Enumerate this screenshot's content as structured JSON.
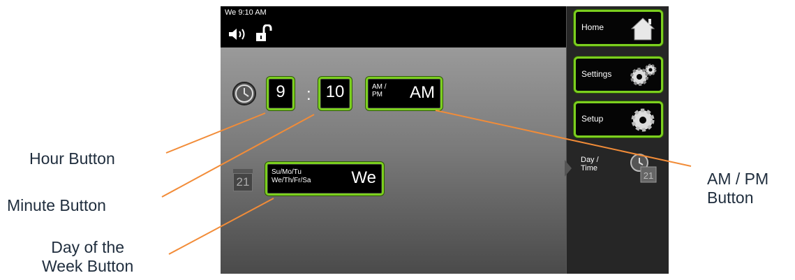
{
  "status": {
    "datetime": "We 9:10 AM"
  },
  "time": {
    "hour": "9",
    "separator": ":",
    "minute": "10",
    "ampm_small": "AM /\nPM",
    "ampm_value": "AM"
  },
  "day": {
    "small": "Su/Mo/Tu\nWe/Th/Fr/Sa",
    "value": "We",
    "calendar_number": "21"
  },
  "sidebar": {
    "home": "Home",
    "settings": "Settings",
    "setup": "Setup",
    "active_tab": "Day /\nTime",
    "tab_calendar_number": "21"
  },
  "callouts": {
    "hour": "Hour Button",
    "minute": "Minute Button",
    "day_of_week": "Day of the\nWeek Button",
    "ampm": "AM / PM\nButton"
  },
  "colors": {
    "accent": "#7ccf1f",
    "callout_line": "#f28c38",
    "callout_text": "#1f2d3d"
  }
}
